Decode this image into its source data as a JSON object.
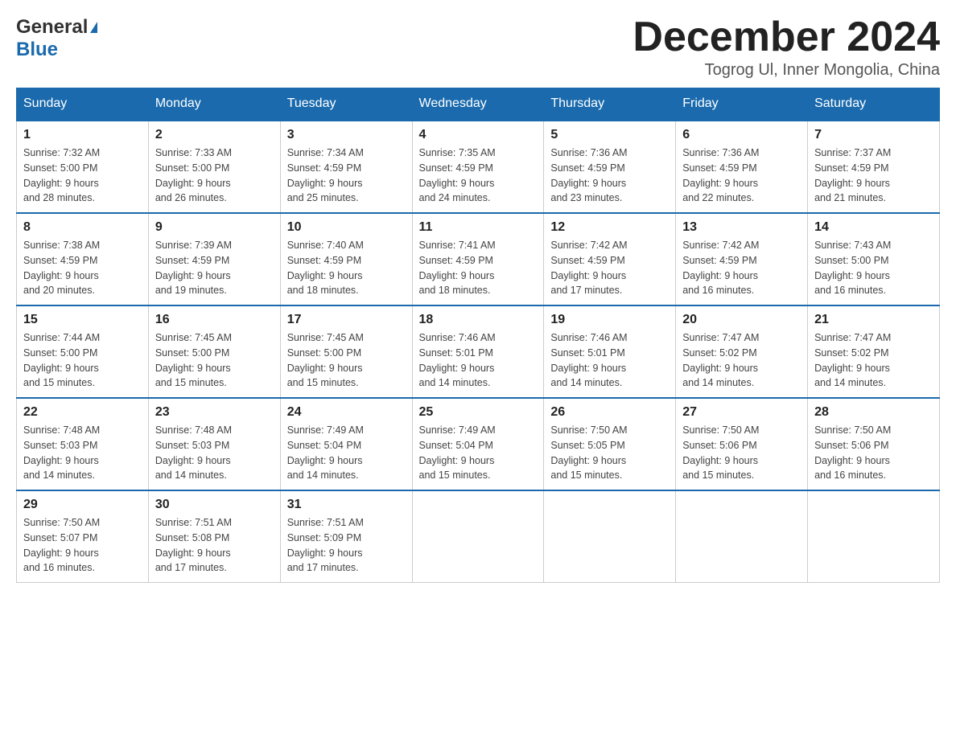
{
  "header": {
    "logo": {
      "general": "General",
      "blue": "Blue"
    },
    "title": "December 2024",
    "location": "Togrog Ul, Inner Mongolia, China"
  },
  "weekdays": [
    "Sunday",
    "Monday",
    "Tuesday",
    "Wednesday",
    "Thursday",
    "Friday",
    "Saturday"
  ],
  "weeks": [
    [
      {
        "day": 1,
        "sunrise": "7:32 AM",
        "sunset": "5:00 PM",
        "daylight": "9 hours and 28 minutes."
      },
      {
        "day": 2,
        "sunrise": "7:33 AM",
        "sunset": "5:00 PM",
        "daylight": "9 hours and 26 minutes."
      },
      {
        "day": 3,
        "sunrise": "7:34 AM",
        "sunset": "4:59 PM",
        "daylight": "9 hours and 25 minutes."
      },
      {
        "day": 4,
        "sunrise": "7:35 AM",
        "sunset": "4:59 PM",
        "daylight": "9 hours and 24 minutes."
      },
      {
        "day": 5,
        "sunrise": "7:36 AM",
        "sunset": "4:59 PM",
        "daylight": "9 hours and 23 minutes."
      },
      {
        "day": 6,
        "sunrise": "7:36 AM",
        "sunset": "4:59 PM",
        "daylight": "9 hours and 22 minutes."
      },
      {
        "day": 7,
        "sunrise": "7:37 AM",
        "sunset": "4:59 PM",
        "daylight": "9 hours and 21 minutes."
      }
    ],
    [
      {
        "day": 8,
        "sunrise": "7:38 AM",
        "sunset": "4:59 PM",
        "daylight": "9 hours and 20 minutes."
      },
      {
        "day": 9,
        "sunrise": "7:39 AM",
        "sunset": "4:59 PM",
        "daylight": "9 hours and 19 minutes."
      },
      {
        "day": 10,
        "sunrise": "7:40 AM",
        "sunset": "4:59 PM",
        "daylight": "9 hours and 18 minutes."
      },
      {
        "day": 11,
        "sunrise": "7:41 AM",
        "sunset": "4:59 PM",
        "daylight": "9 hours and 18 minutes."
      },
      {
        "day": 12,
        "sunrise": "7:42 AM",
        "sunset": "4:59 PM",
        "daylight": "9 hours and 17 minutes."
      },
      {
        "day": 13,
        "sunrise": "7:42 AM",
        "sunset": "4:59 PM",
        "daylight": "9 hours and 16 minutes."
      },
      {
        "day": 14,
        "sunrise": "7:43 AM",
        "sunset": "5:00 PM",
        "daylight": "9 hours and 16 minutes."
      }
    ],
    [
      {
        "day": 15,
        "sunrise": "7:44 AM",
        "sunset": "5:00 PM",
        "daylight": "9 hours and 15 minutes."
      },
      {
        "day": 16,
        "sunrise": "7:45 AM",
        "sunset": "5:00 PM",
        "daylight": "9 hours and 15 minutes."
      },
      {
        "day": 17,
        "sunrise": "7:45 AM",
        "sunset": "5:00 PM",
        "daylight": "9 hours and 15 minutes."
      },
      {
        "day": 18,
        "sunrise": "7:46 AM",
        "sunset": "5:01 PM",
        "daylight": "9 hours and 14 minutes."
      },
      {
        "day": 19,
        "sunrise": "7:46 AM",
        "sunset": "5:01 PM",
        "daylight": "9 hours and 14 minutes."
      },
      {
        "day": 20,
        "sunrise": "7:47 AM",
        "sunset": "5:02 PM",
        "daylight": "9 hours and 14 minutes."
      },
      {
        "day": 21,
        "sunrise": "7:47 AM",
        "sunset": "5:02 PM",
        "daylight": "9 hours and 14 minutes."
      }
    ],
    [
      {
        "day": 22,
        "sunrise": "7:48 AM",
        "sunset": "5:03 PM",
        "daylight": "9 hours and 14 minutes."
      },
      {
        "day": 23,
        "sunrise": "7:48 AM",
        "sunset": "5:03 PM",
        "daylight": "9 hours and 14 minutes."
      },
      {
        "day": 24,
        "sunrise": "7:49 AM",
        "sunset": "5:04 PM",
        "daylight": "9 hours and 14 minutes."
      },
      {
        "day": 25,
        "sunrise": "7:49 AM",
        "sunset": "5:04 PM",
        "daylight": "9 hours and 15 minutes."
      },
      {
        "day": 26,
        "sunrise": "7:50 AM",
        "sunset": "5:05 PM",
        "daylight": "9 hours and 15 minutes."
      },
      {
        "day": 27,
        "sunrise": "7:50 AM",
        "sunset": "5:06 PM",
        "daylight": "9 hours and 15 minutes."
      },
      {
        "day": 28,
        "sunrise": "7:50 AM",
        "sunset": "5:06 PM",
        "daylight": "9 hours and 16 minutes."
      }
    ],
    [
      {
        "day": 29,
        "sunrise": "7:50 AM",
        "sunset": "5:07 PM",
        "daylight": "9 hours and 16 minutes."
      },
      {
        "day": 30,
        "sunrise": "7:51 AM",
        "sunset": "5:08 PM",
        "daylight": "9 hours and 17 minutes."
      },
      {
        "day": 31,
        "sunrise": "7:51 AM",
        "sunset": "5:09 PM",
        "daylight": "9 hours and 17 minutes."
      },
      null,
      null,
      null,
      null
    ]
  ],
  "labels": {
    "sunrise": "Sunrise:",
    "sunset": "Sunset:",
    "daylight": "Daylight:"
  }
}
